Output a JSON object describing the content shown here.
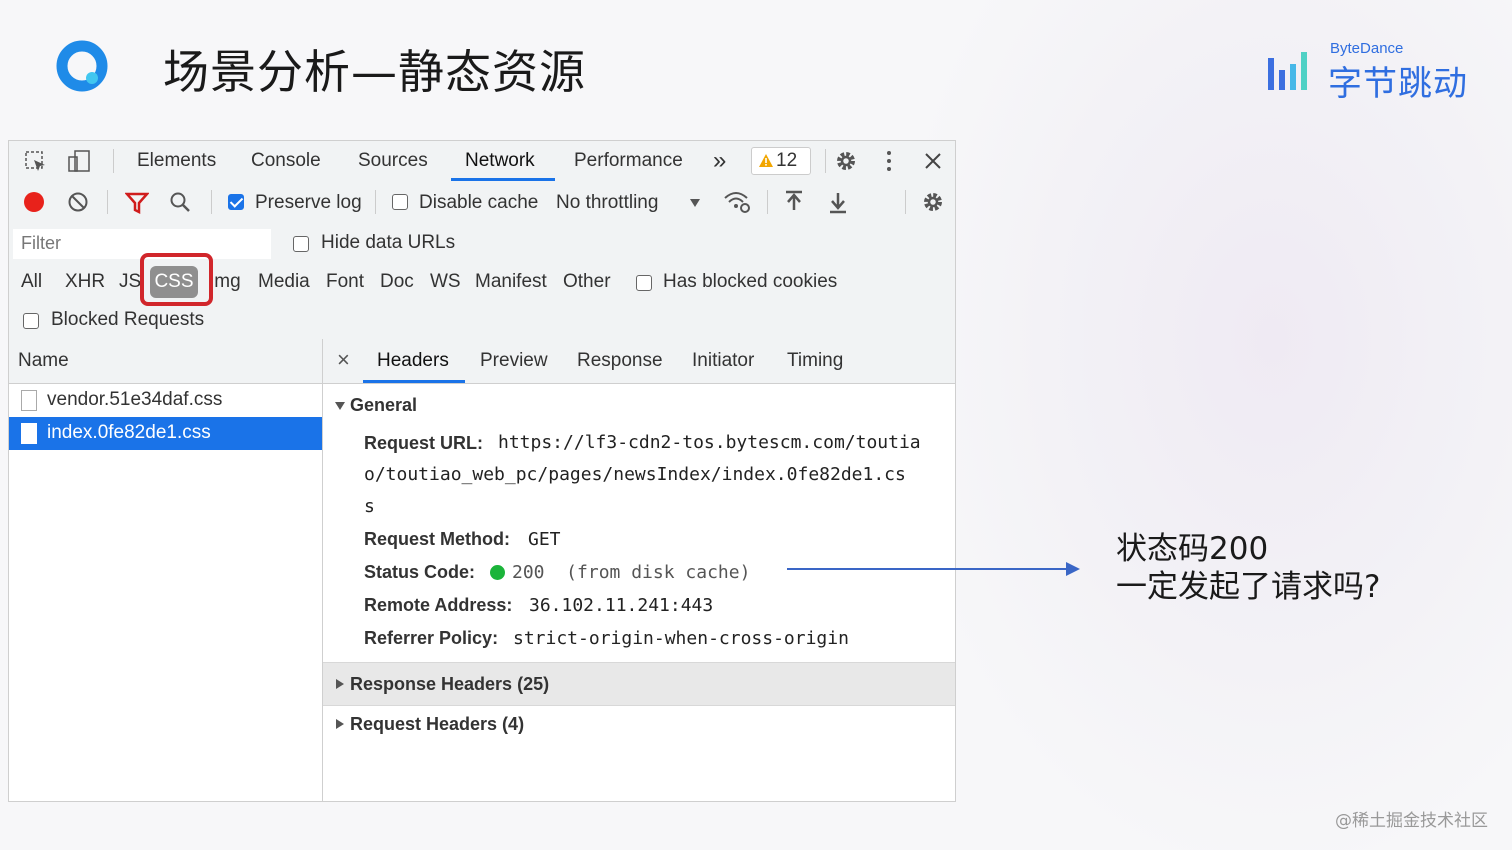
{
  "slide": {
    "title": "场景分析—静态资源",
    "brand_small": "ByteDance",
    "brand_big": "字节跳动",
    "annotation_line1": "状态码200",
    "annotation_line2": "一定发起了请求吗?",
    "footer": "@稀土掘金技术社区"
  },
  "devtools": {
    "tabs": [
      "Elements",
      "Console",
      "Sources",
      "Network",
      "Performance"
    ],
    "active_tab": "Network",
    "more_tabs": "»",
    "warning_count": "12",
    "toolbar": {
      "preserve_log": "Preserve log",
      "preserve_log_checked": true,
      "disable_cache": "Disable cache",
      "throttling": "No throttling"
    },
    "filter": {
      "placeholder": "Filter",
      "hide_data_urls": "Hide data URLs",
      "types": [
        "All",
        "XHR",
        "JS",
        "CSS",
        "Img",
        "Media",
        "Font",
        "Doc",
        "WS",
        "Manifest",
        "Other"
      ],
      "active_type": "CSS",
      "has_blocked_cookies": "Has blocked cookies",
      "blocked_requests": "Blocked Requests"
    },
    "requests": {
      "header": "Name",
      "items": [
        "vendor.51e34daf.css",
        "index.0fe82de1.css"
      ],
      "selected": "index.0fe82de1.css"
    },
    "detail": {
      "close": "×",
      "tabs": [
        "Headers",
        "Preview",
        "Response",
        "Initiator",
        "Timing"
      ],
      "active_tab": "Headers",
      "general_title": "General",
      "request_url_label": "Request URL:",
      "request_url_line1": "https://lf3-cdn2-tos.bytescm.com/toutia",
      "request_url_line2": "o/toutiao_web_pc/pages/newsIndex/index.0fe82de1.cs",
      "request_url_line3": "s",
      "method_label": "Request Method:",
      "method_value": "GET",
      "status_label": "Status Code:",
      "status_value": "200  (from disk cache)",
      "remote_label": "Remote Address:",
      "remote_value": "36.102.11.241:443",
      "referrer_label": "Referrer Policy:",
      "referrer_value": "strict-origin-when-cross-origin",
      "response_headers": "Response Headers (25)",
      "request_headers": "Request Headers (4)"
    }
  },
  "colors": {
    "accent": "#1a73e8",
    "highlight_box": "#d1262b",
    "arrow": "#3a66c6",
    "status_ok": "#1bb43a",
    "record": "#e8221b"
  }
}
